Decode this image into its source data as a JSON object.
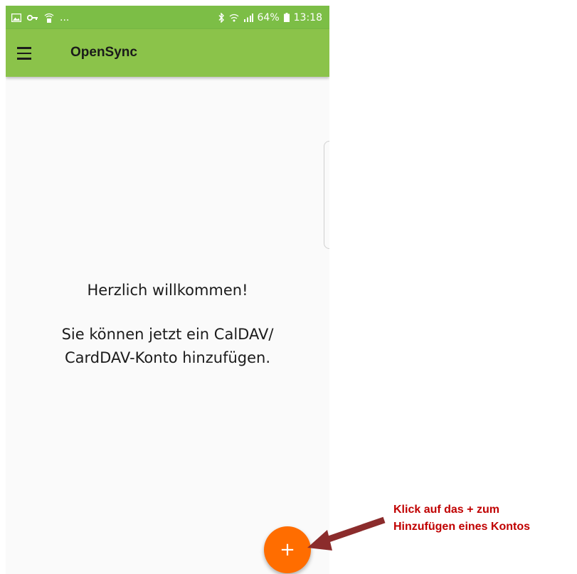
{
  "statusbar": {
    "left_icons": [
      "gallery-icon",
      "key-icon",
      "wifi-lock-icon"
    ],
    "overflow": "...",
    "battery": "64%",
    "time": "13:18"
  },
  "appbar": {
    "title": "OpenSync"
  },
  "welcome": {
    "title": "Herzlich willkommen!",
    "line1": "Sie können jetzt ein CalDAV/",
    "line2": "CardDAV-Konto hinzufügen."
  },
  "fab": {
    "label": "+"
  },
  "annotation": {
    "line1": "Klick auf das + zum",
    "line2": "Hinzufügen eines Kontos"
  },
  "colors": {
    "appbar": "#8bc34a",
    "statusbar": "#7cbe46",
    "fab": "#ff6d00",
    "annotation_text": "#c00000",
    "arrow": "#8b2c2c"
  }
}
